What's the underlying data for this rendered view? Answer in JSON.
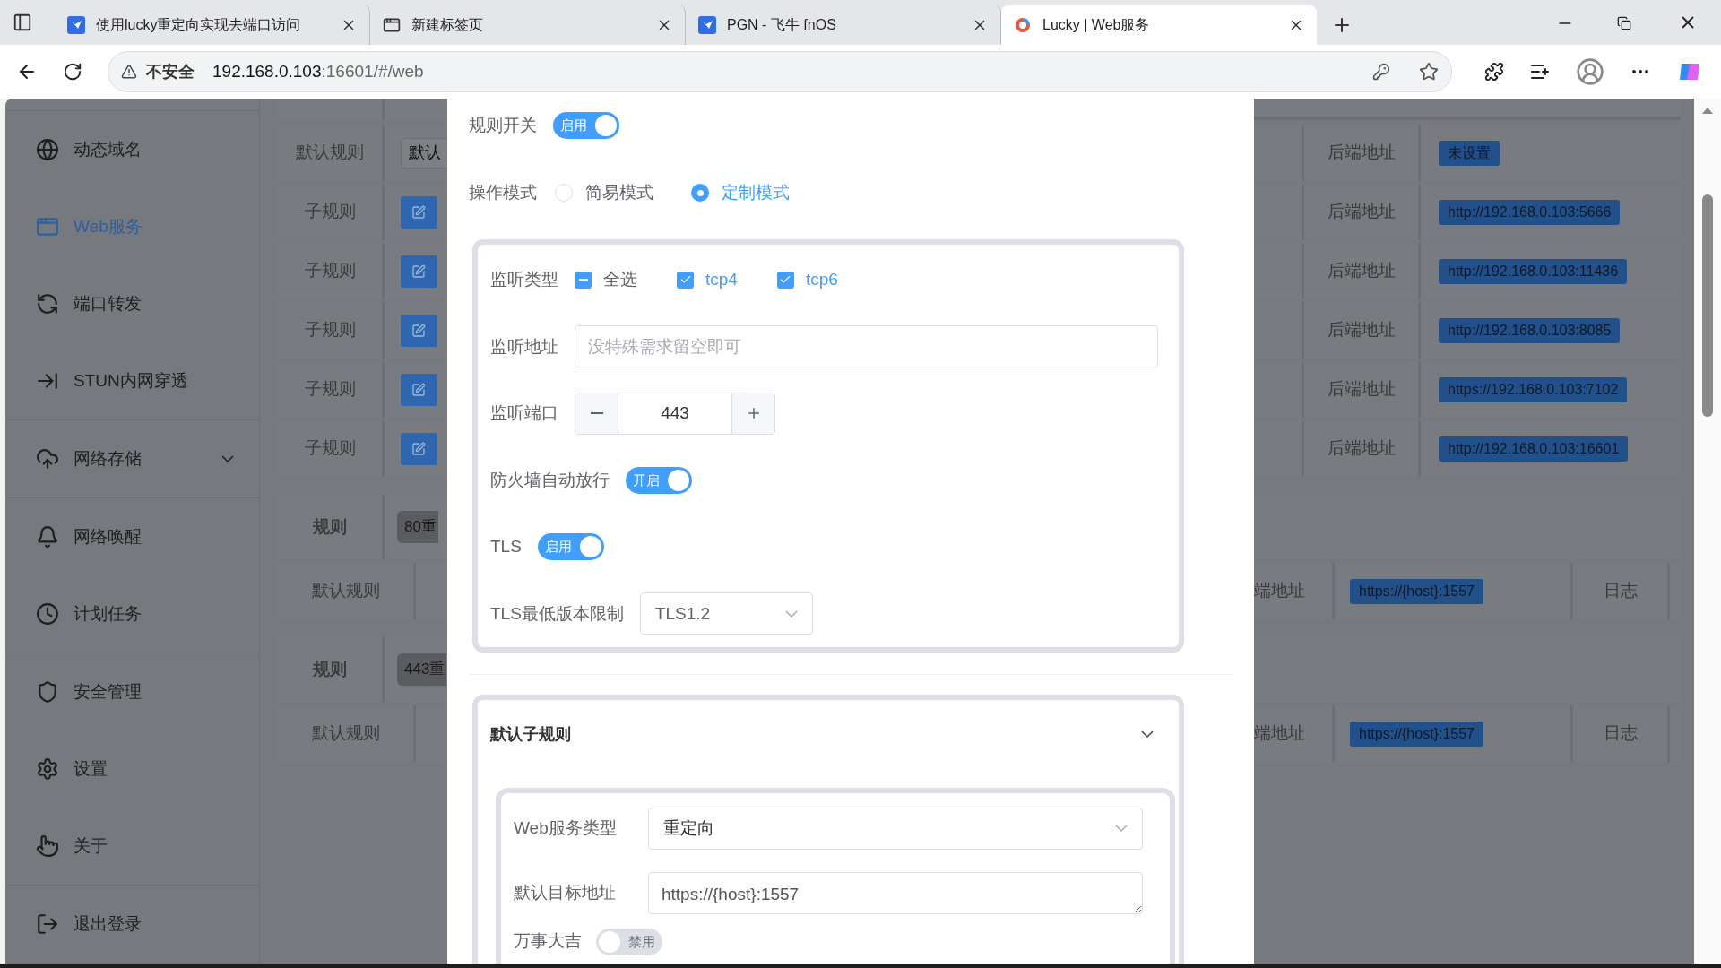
{
  "browser": {
    "tabs": [
      {
        "title": "使用lucky重定向实现去端口访问",
        "selected": false
      },
      {
        "title": "新建标签页",
        "selected": false
      },
      {
        "title": "PGN - 飞牛 fnOS",
        "selected": false
      },
      {
        "title": "Lucky | Web服务",
        "selected": true
      }
    ],
    "address": {
      "security": "不安全",
      "host": "192.168.0.103",
      "rest": ":16601/#/web"
    }
  },
  "sidebar": {
    "groups": [
      {
        "items": [
          {
            "label": "动态域名",
            "selected": false,
            "submenu": false
          },
          {
            "label": "Web服务",
            "selected": true,
            "submenu": false
          },
          {
            "label": "端口转发",
            "selected": false,
            "submenu": false
          },
          {
            "label": "STUN内网穿透",
            "selected": false,
            "submenu": false
          }
        ]
      },
      {
        "items": [
          {
            "label": "网络存储",
            "selected": false,
            "submenu": true
          }
        ]
      },
      {
        "items": [
          {
            "label": "网络唤醒",
            "selected": false,
            "submenu": false
          },
          {
            "label": "计划任务",
            "selected": false,
            "submenu": false
          }
        ]
      },
      {
        "items": [
          {
            "label": "安全管理",
            "selected": false,
            "submenu": false
          },
          {
            "label": "设置",
            "selected": false,
            "submenu": false
          },
          {
            "label": "关于",
            "selected": false,
            "submenu": false
          }
        ]
      },
      {
        "items": [
          {
            "label": "退出登录",
            "selected": false,
            "submenu": false
          }
        ]
      }
    ]
  },
  "rules_table": {
    "rows": [
      {
        "kind": "default",
        "label": "默认规则",
        "tag": "默认",
        "backend_label": "后端地址",
        "backend": "未设置"
      },
      {
        "kind": "sub",
        "label": "子规则",
        "backend_label": "后端地址",
        "backend": "http://192.168.0.103:5666"
      },
      {
        "kind": "sub",
        "label": "子规则",
        "backend_label": "后端地址",
        "backend": "http://192.168.0.103:11436"
      },
      {
        "kind": "sub",
        "label": "子规则",
        "backend_label": "后端地址",
        "backend": "http://192.168.0.103:8085"
      },
      {
        "kind": "sub",
        "label": "子规则",
        "backend_label": "后端地址",
        "backend": "https://192.168.0.103:7102"
      },
      {
        "kind": "sub",
        "label": "子规则",
        "backend_label": "后端地址",
        "backend": "http://192.168.0.103:16601"
      },
      {
        "kind": "rule",
        "label": "规则",
        "tag": "80重"
      },
      {
        "kind": "target",
        "label": "默认规则",
        "backend_label": "端地址",
        "backend": "https://{host}:1557",
        "log": "日志"
      },
      {
        "kind": "rule",
        "label": "规则",
        "tag": "443重"
      },
      {
        "kind": "target",
        "label": "默认规则",
        "backend_label": "端地址",
        "backend": "https://{host}:1557",
        "log": "日志"
      }
    ]
  },
  "modal": {
    "rule_switch": {
      "label": "规则开关",
      "on": true,
      "text": "启用"
    },
    "mode": {
      "label": "操作模式",
      "options": [
        {
          "label": "简易模式",
          "selected": false
        },
        {
          "label": "定制模式",
          "selected": true
        }
      ]
    },
    "listen": {
      "type_label": "监听类型",
      "types": [
        {
          "label": "全选",
          "checked": true,
          "indeterminate": true
        },
        {
          "label": "tcp4",
          "checked": true,
          "indeterminate": false
        },
        {
          "label": "tcp6",
          "checked": true,
          "indeterminate": false
        }
      ],
      "address": {
        "label": "监听地址",
        "placeholder": "没特殊需求留空即可"
      },
      "port": {
        "label": "监听端口",
        "value": "443"
      },
      "firewall": {
        "label": "防火墙自动放行",
        "on": true,
        "text": "开启"
      },
      "tls": {
        "label": "TLS",
        "on": true,
        "text": "启用"
      },
      "tls_min": {
        "label": "TLS最低版本限制",
        "value": "TLS1.2"
      }
    },
    "default_subrule": {
      "title": "默认子规则",
      "expanded": true,
      "service_type": {
        "label": "Web服务类型",
        "value": "重定向"
      },
      "target": {
        "label": "默认目标地址",
        "value": "https://{host}:1557"
      },
      "all_good": {
        "label": "万事大吉",
        "on": false,
        "text": "禁用"
      }
    }
  }
}
